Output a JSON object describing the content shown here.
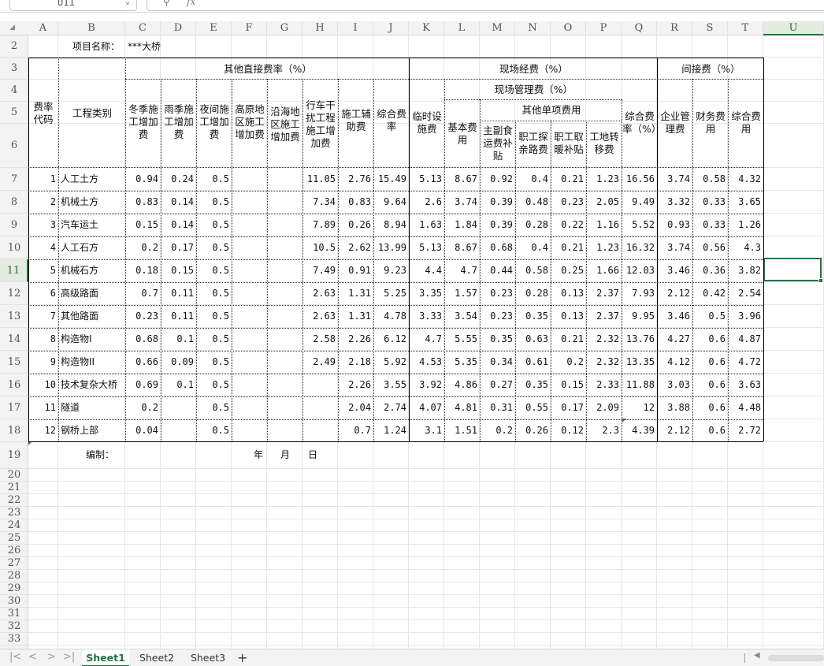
{
  "formula_bar": {
    "name_box": "U11",
    "zoom_icon": "zoom-icon",
    "fx_label": "fx"
  },
  "columns": [
    "A",
    "B",
    "C",
    "D",
    "E",
    "F",
    "G",
    "H",
    "I",
    "J",
    "K",
    "L",
    "M",
    "N",
    "O",
    "P",
    "Q",
    "R",
    "S",
    "T",
    "U"
  ],
  "selected_column": "U",
  "rows_visible": [
    "2",
    "3",
    "4",
    "5",
    "6",
    "7",
    "8",
    "9",
    "10",
    "11",
    "12",
    "13",
    "14",
    "15",
    "16",
    "17",
    "18",
    "19",
    "20",
    "21",
    "22",
    "23",
    "24",
    "25",
    "26",
    "27",
    "28",
    "29",
    "30",
    "31",
    "32",
    "33"
  ],
  "selected_row": "11",
  "project": {
    "label": "项目名称：",
    "value": "***大桥"
  },
  "headers": {
    "code": "费率代码",
    "category": "工程类别",
    "other_direct": "其他直接费率（%）",
    "winter": "冬季施工增加费",
    "rain": "雨季施工增加费",
    "night": "夜间施工增加费",
    "plateau": "高原地区施工增加费",
    "coastal": "沿海地区施工增加费",
    "traffic": "行车干扰工程施工增加费",
    "aux": "施工辅助费",
    "comp_rate": "综合费率",
    "site": "现场经费（%）",
    "temp": "临时设施费",
    "site_mgmt": "现场管理费（%）",
    "basic": "基本费用",
    "other_items": "其他单项费用",
    "food": "主副食运费补贴",
    "family": "职工探亲路费",
    "heating": "职工取暖补贴",
    "transfer": "工地转移费",
    "site_comp": "综合费率（%）",
    "indirect": "间接费（%）",
    "enterprise": "企业管理费",
    "finance": "财务费用",
    "indirect_comp": "综合费用"
  },
  "table": {
    "rows": [
      {
        "code": "1",
        "name": "人工土方",
        "c": "0.94",
        "d": "0.24",
        "e": "0.5",
        "f": "",
        "g": "",
        "h": "11.05",
        "i": "2.76",
        "j": "15.49",
        "k": "5.13",
        "l": "8.67",
        "m": "0.92",
        "n": "0.4",
        "o": "0.21",
        "p": "1.23",
        "q": "16.56",
        "r": "3.74",
        "s": "0.58",
        "t": "4.32"
      },
      {
        "code": "2",
        "name": "机械土方",
        "c": "0.83",
        "d": "0.14",
        "e": "0.5",
        "f": "",
        "g": "",
        "h": "7.34",
        "i": "0.83",
        "j": "9.64",
        "k": "2.6",
        "l": "3.74",
        "m": "0.39",
        "n": "0.48",
        "o": "0.23",
        "p": "2.05",
        "q": "9.49",
        "r": "3.32",
        "s": "0.33",
        "t": "3.65"
      },
      {
        "code": "3",
        "name": "汽车运土",
        "c": "0.15",
        "d": "0.14",
        "e": "0.5",
        "f": "",
        "g": "",
        "h": "7.89",
        "i": "0.26",
        "j": "8.94",
        "k": "1.63",
        "l": "1.84",
        "m": "0.39",
        "n": "0.28",
        "o": "0.22",
        "p": "1.16",
        "q": "5.52",
        "r": "0.93",
        "s": "0.33",
        "t": "1.26"
      },
      {
        "code": "4",
        "name": "人工石方",
        "c": "0.2",
        "d": "0.17",
        "e": "0.5",
        "f": "",
        "g": "",
        "h": "10.5",
        "i": "2.62",
        "j": "13.99",
        "k": "5.13",
        "l": "8.67",
        "m": "0.68",
        "n": "0.4",
        "o": "0.21",
        "p": "1.23",
        "q": "16.32",
        "r": "3.74",
        "s": "0.56",
        "t": "4.3"
      },
      {
        "code": "5",
        "name": "机械石方",
        "c": "0.18",
        "d": "0.15",
        "e": "0.5",
        "f": "",
        "g": "",
        "h": "7.49",
        "i": "0.91",
        "j": "9.23",
        "k": "4.4",
        "l": "4.7",
        "m": "0.44",
        "n": "0.58",
        "o": "0.25",
        "p": "1.66",
        "q": "12.03",
        "r": "3.46",
        "s": "0.36",
        "t": "3.82"
      },
      {
        "code": "6",
        "name": "高级路面",
        "c": "0.7",
        "d": "0.11",
        "e": "0.5",
        "f": "",
        "g": "",
        "h": "2.63",
        "i": "1.31",
        "j": "5.25",
        "k": "3.35",
        "l": "1.57",
        "m": "0.23",
        "n": "0.28",
        "o": "0.13",
        "p": "2.37",
        "q": "7.93",
        "r": "2.12",
        "s": "0.42",
        "t": "2.54"
      },
      {
        "code": "7",
        "name": "其他路面",
        "c": "0.23",
        "d": "0.11",
        "e": "0.5",
        "f": "",
        "g": "",
        "h": "2.63",
        "i": "1.31",
        "j": "4.78",
        "k": "3.33",
        "l": "3.54",
        "m": "0.23",
        "n": "0.35",
        "o": "0.13",
        "p": "2.37",
        "q": "9.95",
        "r": "3.46",
        "s": "0.5",
        "t": "3.96"
      },
      {
        "code": "8",
        "name": "构造物I",
        "c": "0.68",
        "d": "0.1",
        "e": "0.5",
        "f": "",
        "g": "",
        "h": "2.58",
        "i": "2.26",
        "j": "6.12",
        "k": "4.7",
        "l": "5.55",
        "m": "0.35",
        "n": "0.63",
        "o": "0.21",
        "p": "2.32",
        "q": "13.76",
        "r": "4.27",
        "s": "0.6",
        "t": "4.87"
      },
      {
        "code": "9",
        "name": "构造物II",
        "c": "0.66",
        "d": "0.09",
        "e": "0.5",
        "f": "",
        "g": "",
        "h": "2.49",
        "i": "2.18",
        "j": "5.92",
        "k": "4.53",
        "l": "5.35",
        "m": "0.34",
        "n": "0.61",
        "o": "0.2",
        "p": "2.32",
        "q": "13.35",
        "r": "4.12",
        "s": "0.6",
        "t": "4.72"
      },
      {
        "code": "10",
        "name": "技术复杂大桥",
        "c": "0.69",
        "d": "0.1",
        "e": "0.5",
        "f": "",
        "g": "",
        "h": "",
        "i": "2.26",
        "j": "3.55",
        "k": "3.92",
        "l": "4.86",
        "m": "0.27",
        "n": "0.35",
        "o": "0.15",
        "p": "2.33",
        "q": "11.88",
        "r": "3.03",
        "s": "0.6",
        "t": "3.63"
      },
      {
        "code": "11",
        "name": "隧道",
        "c": "0.2",
        "d": "",
        "e": "0.5",
        "f": "",
        "g": "",
        "h": "",
        "i": "2.04",
        "j": "2.74",
        "k": "4.07",
        "l": "4.81",
        "m": "0.31",
        "n": "0.55",
        "o": "0.17",
        "p": "2.09",
        "q": "12",
        "r": "3.88",
        "s": "0.6",
        "t": "4.48"
      },
      {
        "code": "12",
        "name": "钢桥上部",
        "c": "0.04",
        "d": "",
        "e": "0.5",
        "f": "",
        "g": "",
        "h": "",
        "i": "0.7",
        "j": "1.24",
        "k": "3.1",
        "l": "1.51",
        "m": "0.2",
        "n": "0.26",
        "o": "0.12",
        "p": "2.3",
        "q": "4.39",
        "r": "2.12",
        "s": "0.6",
        "t": "2.72"
      }
    ]
  },
  "footer": {
    "compiled": "编制：",
    "year": "年",
    "month": "月",
    "day": "日"
  },
  "sheet_tabs": [
    "Sheet1",
    "Sheet2",
    "Sheet3"
  ],
  "active_sheet": "Sheet1",
  "add_sheet": "+",
  "colors": {
    "accent": "#217346",
    "select_fill": "#e3ecdf"
  }
}
